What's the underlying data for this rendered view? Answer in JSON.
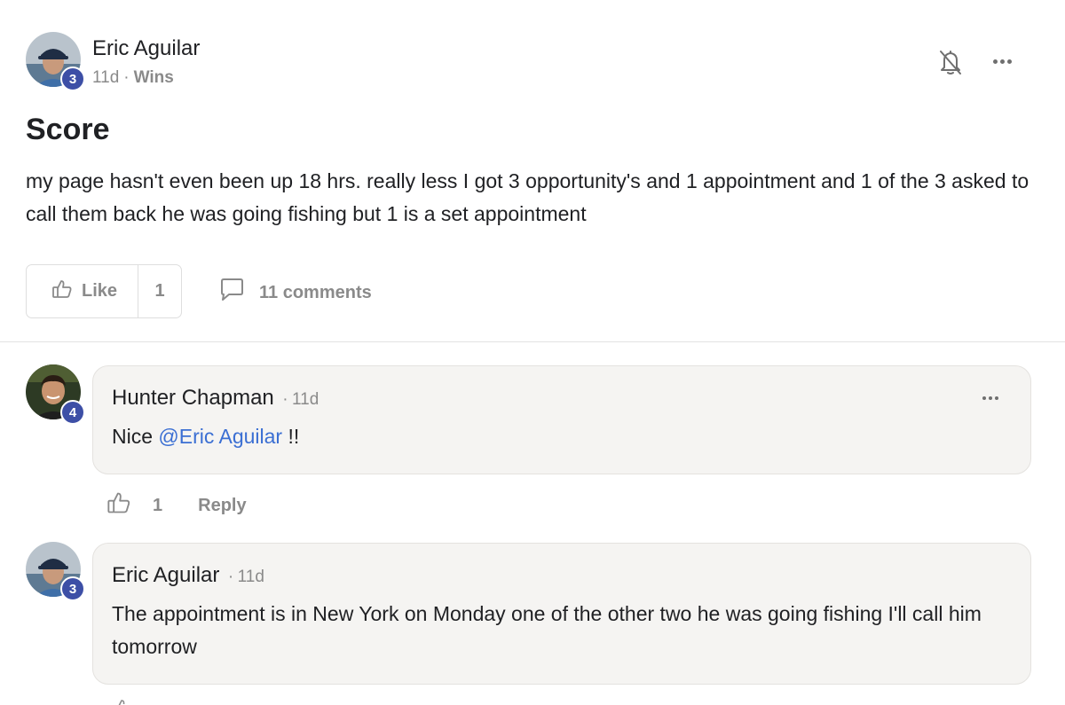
{
  "post": {
    "author": "Eric Aguilar",
    "author_level": "3",
    "time": "11d",
    "separator": "·",
    "category": "Wins",
    "title": "Score",
    "body": "my page hasn't even been up 18 hrs. really less I got 3 opportunity's and 1 appointment and 1 of the 3 asked to call them back he was going fishing but 1 is a set appointment",
    "like_label": "Like",
    "like_count": "1",
    "comments_label": "11 comments"
  },
  "comments": [
    {
      "author": "Hunter Chapman",
      "level": "4",
      "separator": "·",
      "time": "11d",
      "text_before": "Nice ",
      "mention": "@Eric Aguilar",
      "text_after": " !!",
      "like_count": "1",
      "reply_label": "Reply"
    },
    {
      "author": "Eric Aguilar",
      "level": "3",
      "separator": "·",
      "time": "11d",
      "text": "The appointment is in New York on Monday one of the other two he was going fishing I'll call him tomorrow"
    }
  ],
  "icons": {
    "bell": "bell-off-icon",
    "more": "more-horizontal-icon",
    "like": "thumbs-up-icon",
    "comment": "comment-bubble-icon"
  },
  "colors": {
    "level_badge": "#3d4fa6",
    "mention": "#3b6fd3",
    "muted": "#8a8a8a",
    "bubble_bg": "#f5f4f2"
  }
}
